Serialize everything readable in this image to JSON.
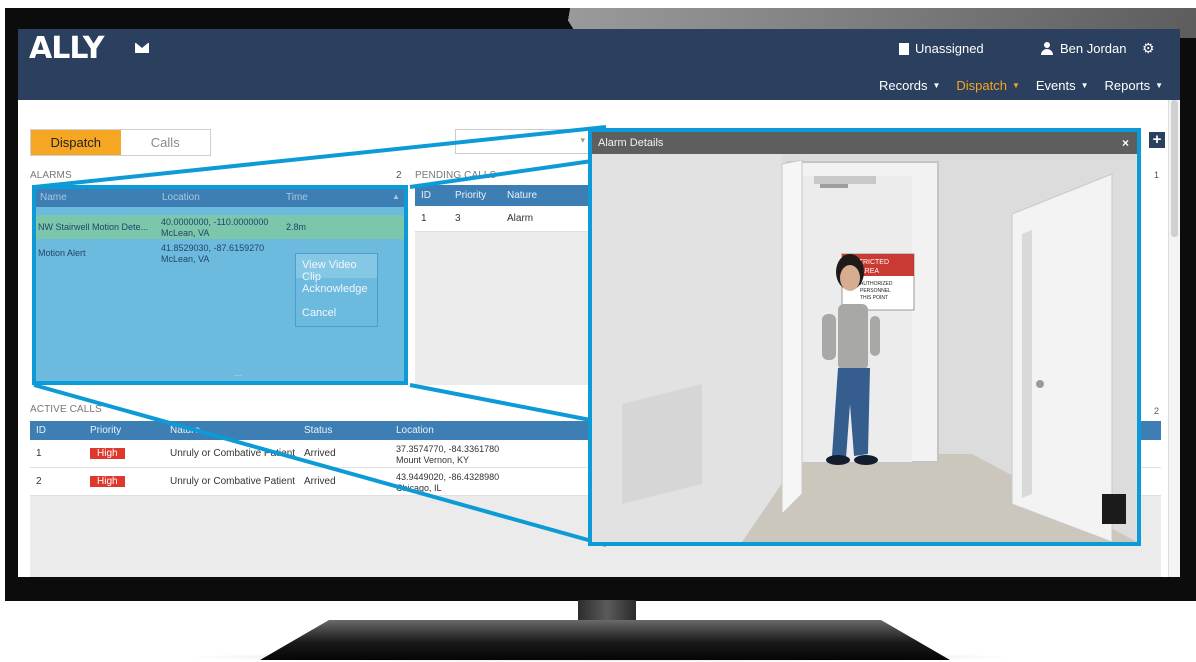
{
  "app": {
    "logo": "ALLY",
    "status": "Unassigned",
    "user": "Ben Jordan"
  },
  "nav": {
    "items": [
      "Records",
      "Dispatch",
      "Events",
      "Reports"
    ],
    "active": "Dispatch"
  },
  "tabs": [
    {
      "label": "Dispatch",
      "active": true
    },
    {
      "label": "Calls",
      "active": false
    }
  ],
  "alarms": {
    "title": "ALARMS",
    "count": "2",
    "columns": [
      "Name",
      "Location",
      "Time"
    ],
    "rows": [
      {
        "name": "NW Stairwell Motion Dete...",
        "location": [
          "40.0000000, -110.0000000",
          "McLean, VA"
        ],
        "time": "2.8m",
        "selected": true
      },
      {
        "name": "Motion Alert",
        "location": [
          "41.8529030, -87.6159270",
          "McLean, VA"
        ],
        "time": "",
        "selected": false
      }
    ],
    "context_menu": [
      "View Video Clip",
      "Acknowledge",
      "Cancel"
    ]
  },
  "pending_calls": {
    "title": "PENDING CALLS",
    "columns": [
      "ID",
      "Priority",
      "Nature"
    ],
    "rows": [
      {
        "id": "1",
        "priority": "3",
        "nature": "Alarm"
      }
    ]
  },
  "active_calls": {
    "title": "ACTIVE CALLS",
    "columns": [
      "ID",
      "Priority",
      "Nature",
      "Status",
      "Location"
    ],
    "rows": [
      {
        "id": "1",
        "priority": "High",
        "nature": "Unruly or Combative Patient",
        "status": "Arrived",
        "location": [
          "37.3574770, -84.3361780",
          "Mount Vernon, KY"
        ]
      },
      {
        "id": "2",
        "priority": "High",
        "nature": "Unruly or Combative Patient",
        "status": "Arrived",
        "location": [
          "43.9449020, -86.4328980",
          "Chicago, IL"
        ]
      }
    ]
  },
  "right_counts": {
    "pending": "1",
    "active": "2"
  },
  "alarm_details": {
    "title": "Alarm Details",
    "sign_lines": [
      "STRICTED",
      "AREA",
      "AUTHORIZED",
      "PERSONNEL",
      "THIS POINT"
    ]
  },
  "colors": {
    "header": "#2b3f5e",
    "accent": "#f5a623",
    "highlight": "#0c9bd6",
    "danger": "#e0372c"
  }
}
